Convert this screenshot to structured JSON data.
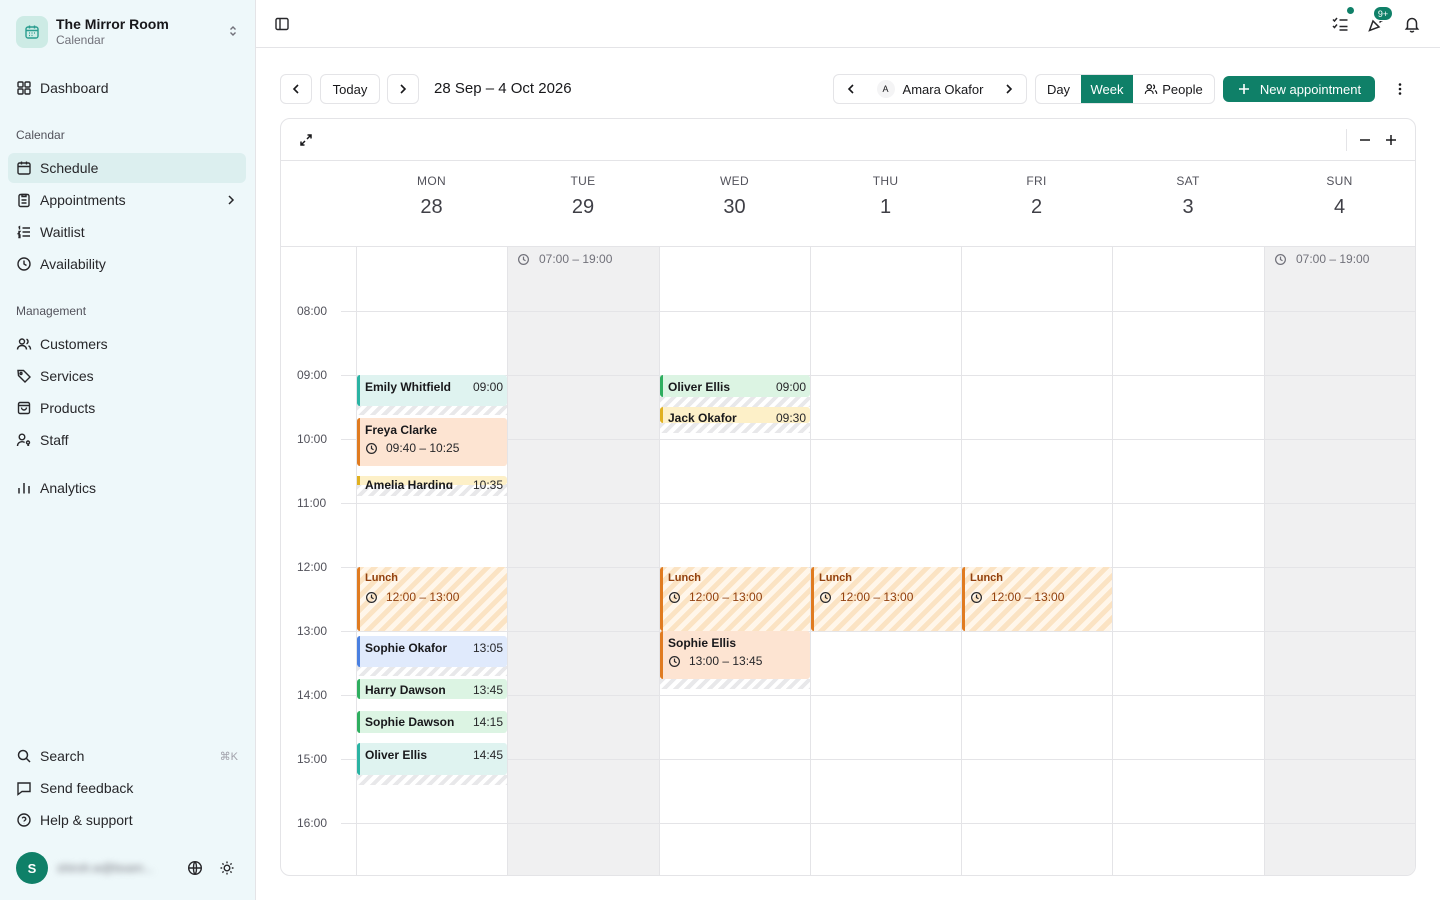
{
  "brand": {
    "name": "The Mirror Room",
    "sub": "Calendar"
  },
  "nav": {
    "dashboard": "Dashboard",
    "group_calendar": "Calendar",
    "schedule": "Schedule",
    "appointments": "Appointments",
    "waitlist": "Waitlist",
    "availability": "Availability",
    "group_management": "Management",
    "customers": "Customers",
    "services": "Services",
    "products": "Products",
    "staff": "Staff",
    "analytics": "Analytics",
    "search": "Search",
    "search_kbd": "⌘K",
    "feedback": "Send feedback",
    "help": "Help & support"
  },
  "user": {
    "initial": "S",
    "email": "shiroh.w@bxam..."
  },
  "topbar": {
    "notif_badge": "9+"
  },
  "toolbar": {
    "today": "Today",
    "range": "28 Sep – 4 Oct 2026",
    "staff_initial": "A",
    "staff_name": "Amara Okafor",
    "view_day": "Day",
    "view_week": "Week",
    "view_people": "People",
    "new_appointment": "New appointment"
  },
  "days": [
    {
      "dow": "MON",
      "num": "28"
    },
    {
      "dow": "TUE",
      "num": "29"
    },
    {
      "dow": "WED",
      "num": "30"
    },
    {
      "dow": "THU",
      "num": "1"
    },
    {
      "dow": "FRI",
      "num": "2"
    },
    {
      "dow": "SAT",
      "num": "3"
    },
    {
      "dow": "SUN",
      "num": "4"
    }
  ],
  "hours": [
    "08:00",
    "09:00",
    "10:00",
    "11:00",
    "12:00",
    "13:00",
    "14:00",
    "15:00",
    "16:00"
  ],
  "availability": {
    "tue": "07:00 – 19:00",
    "sun": "07:00 – 19:00"
  },
  "colors": {
    "accent": "#0f8068",
    "teal": "#2bb3a3",
    "orange": "#e07b20",
    "yellow": "#e0b020",
    "blue": "#4a80e0",
    "green": "#2fae5f"
  },
  "events": {
    "mon": [
      {
        "name": "Emily Whitfield",
        "time": "09:00"
      },
      {
        "name": "Freya Clarke",
        "range": "09:40 – 10:25"
      },
      {
        "name": "Amelia Harding",
        "time": "10:35"
      },
      {
        "name": "Lunch",
        "range": "12:00 – 13:00"
      },
      {
        "name": "Sophie Okafor",
        "time": "13:05"
      },
      {
        "name": "Harry Dawson",
        "time": "13:45"
      },
      {
        "name": "Sophie Dawson",
        "time": "14:15"
      },
      {
        "name": "Oliver Ellis",
        "time": "14:45"
      }
    ],
    "wed": [
      {
        "name": "Oliver Ellis",
        "time": "09:00"
      },
      {
        "name": "Jack Okafor",
        "time": "09:30"
      },
      {
        "name": "Lunch",
        "range": "12:00 – 13:00"
      },
      {
        "name": "Sophie Ellis",
        "range": "13:00 – 13:45"
      }
    ],
    "thu": [
      {
        "name": "Lunch",
        "range": "12:00 – 13:00"
      }
    ],
    "fri": [
      {
        "name": "Lunch",
        "range": "12:00 – 13:00"
      }
    ]
  }
}
